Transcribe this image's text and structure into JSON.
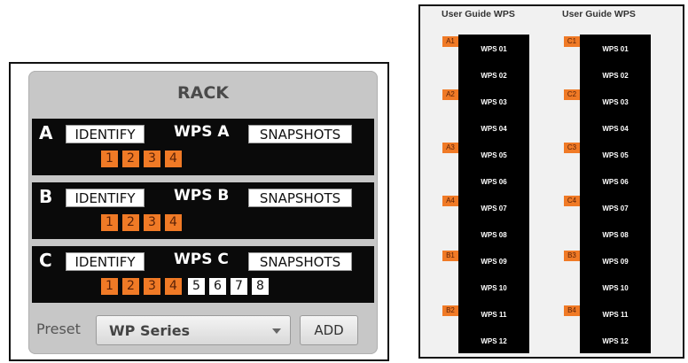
{
  "rack": {
    "title": "RACK",
    "rows": [
      {
        "letter": "A",
        "identify_label": "IDENTIFY",
        "name": "WPS A",
        "snapshots_label": "SNAPSHOTS",
        "channels": [
          "1",
          "2",
          "3",
          "4"
        ]
      },
      {
        "letter": "B",
        "identify_label": "IDENTIFY",
        "name": "WPS B",
        "snapshots_label": "SNAPSHOTS",
        "channels": [
          "1",
          "2",
          "3",
          "4"
        ]
      },
      {
        "letter": "C",
        "identify_label": "IDENTIFY",
        "name": "WPS C",
        "snapshots_label": "SNAPSHOTS",
        "channels": [
          "1",
          "2",
          "3",
          "4"
        ],
        "extra_channels": [
          "5",
          "6",
          "7",
          "8"
        ]
      }
    ],
    "preset_label": "Preset",
    "preset_value": "WP Series",
    "add_label": "ADD"
  },
  "guide": {
    "columns": [
      {
        "header": "User Guide WPS",
        "units": [
          "WPS 01",
          "WPS 02",
          "WPS 03",
          "WPS 04",
          "WPS 05",
          "WPS 06",
          "WPS 07",
          "WPS 08",
          "WPS 09",
          "WPS 10",
          "WPS 11",
          "WPS 12"
        ],
        "tags": [
          "A1",
          "A2",
          "A3",
          "A4",
          "B1",
          "B2"
        ]
      },
      {
        "header": "User Guide WPS",
        "units": [
          "WPS 01",
          "WPS 02",
          "WPS 03",
          "WPS 04",
          "WPS 05",
          "WPS 06",
          "WPS 07",
          "WPS 08",
          "WPS 09",
          "WPS 10",
          "WPS 11",
          "WPS 12"
        ],
        "tags": [
          "C1",
          "C2",
          "C3",
          "C4",
          "B3",
          "B4"
        ]
      }
    ]
  },
  "colors": {
    "accent_orange": "#f07a26",
    "panel_gray": "#c7c7c7",
    "row_black": "#0a0a0a"
  }
}
